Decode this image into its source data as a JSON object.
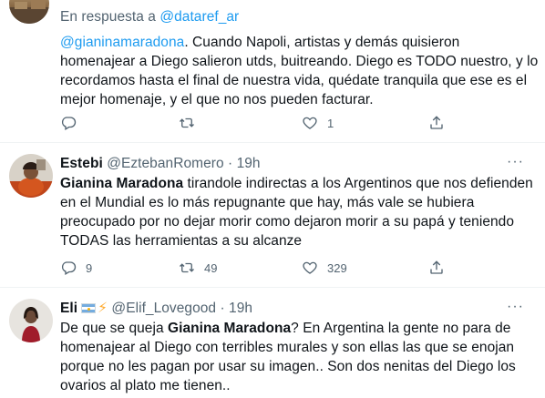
{
  "tweets": [
    {
      "reply_prefix": "En respuesta a ",
      "reply_handle": "@dataref_ar",
      "body": [
        {
          "mention": "@gianinamaradona",
          "text": ". Cuando Napoli, artistas y demás quisieron"
        },
        {
          "text": "homenajear a Diego salieron utds, buitreando. Diego es TODO nuestro, y lo"
        },
        {
          "text": "recordamos hasta el final de nuestra vida, quédate tranquila que ese es el"
        },
        {
          "text": "mejor homenaje, y el que no nos pueden facturar."
        }
      ],
      "actions": {
        "reply": "",
        "retweet": "",
        "like": "1",
        "share": ""
      }
    },
    {
      "name": "Estebi",
      "handle": "@EztebanRomero",
      "dot": "·",
      "time": "19h",
      "more": "···",
      "body": [
        {
          "bold": "Gianina Maradona",
          "text": " tirandole indirectas a los Argentinos que nos defienden"
        },
        {
          "text": "en el Mundial es lo más repugnante que hay, más vale se hubiera"
        },
        {
          "text": "preocupado por no dejar morir como dejaron morir a su papá y teniendo"
        },
        {
          "text": "TODAS las herramientas a su alcanze"
        }
      ],
      "actions": {
        "reply": "9",
        "retweet": "49",
        "like": "329",
        "share": ""
      }
    },
    {
      "name": "Eli",
      "emoji_bolt": "⚡",
      "handle": "@Elif_Lovegood",
      "dot": "·",
      "time": "19h",
      "more": "···",
      "body": [
        {
          "pre": "De que se queja ",
          "bold": "Gianina Maradona",
          "text": "? En Argentina la gente no para de"
        },
        {
          "text": "homenajear al Diego con terribles murales y son ellas las que se enojan"
        },
        {
          "text": "porque no les pagan por usar su imagen.. Son dos nenitas del Diego los"
        },
        {
          "text": "ovarios al plato me tienen.."
        }
      ]
    }
  ],
  "icons": {
    "reply": "reply-icon",
    "retweet": "retweet-icon",
    "like": "heart-icon",
    "share": "share-icon"
  },
  "colors": {
    "text": "#0f1419",
    "muted": "#536471",
    "link": "#1d9bf0",
    "divider": "#eff3f4",
    "flag_blue": "#74acdf",
    "bolt": "#ffac33"
  }
}
